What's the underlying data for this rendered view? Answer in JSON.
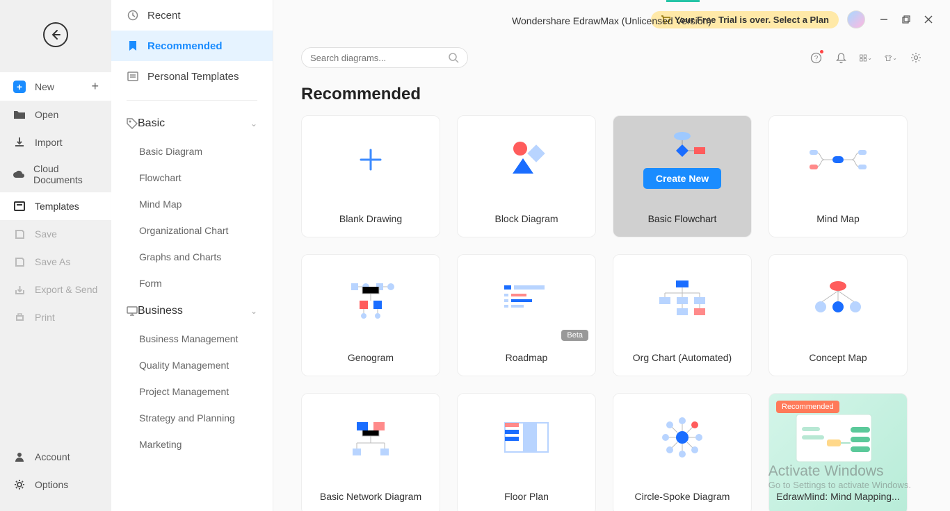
{
  "app_title": "Wondershare EdrawMax (Unlicensed Version)",
  "trial_banner": "Your Free Trial is over. Select a Plan",
  "search_placeholder": "Search diagrams...",
  "section_heading": "Recommended",
  "left_menu": {
    "new": "New",
    "open": "Open",
    "import": "Import",
    "cloud": "Cloud Documents",
    "templates": "Templates",
    "save": "Save",
    "save_as": "Save As",
    "export": "Export & Send",
    "print": "Print",
    "account": "Account",
    "options": "Options"
  },
  "categories": {
    "recent": "Recent",
    "recommended": "Recommended",
    "personal": "Personal Templates",
    "basic": {
      "label": "Basic",
      "items": [
        "Basic Diagram",
        "Flowchart",
        "Mind Map",
        "Organizational Chart",
        "Graphs and Charts",
        "Form"
      ]
    },
    "business": {
      "label": "Business",
      "items": [
        "Business Management",
        "Quality Management",
        "Project Management",
        "Strategy and Planning",
        "Marketing"
      ]
    }
  },
  "cards": [
    {
      "label": "Blank Drawing"
    },
    {
      "label": "Block Diagram"
    },
    {
      "label": "Basic Flowchart",
      "create": "Create New"
    },
    {
      "label": "Mind Map"
    },
    {
      "label": "Genogram"
    },
    {
      "label": "Roadmap",
      "badge": "Beta"
    },
    {
      "label": "Org Chart (Automated)"
    },
    {
      "label": "Concept Map"
    },
    {
      "label": "Basic Network Diagram"
    },
    {
      "label": "Floor Plan"
    },
    {
      "label": "Circle-Spoke Diagram"
    },
    {
      "label": "EdrawMind: Mind Mapping...",
      "recommended": "Recommended"
    }
  ],
  "watermark": {
    "line1": "Activate Windows",
    "line2": "Go to Settings to activate Windows."
  }
}
